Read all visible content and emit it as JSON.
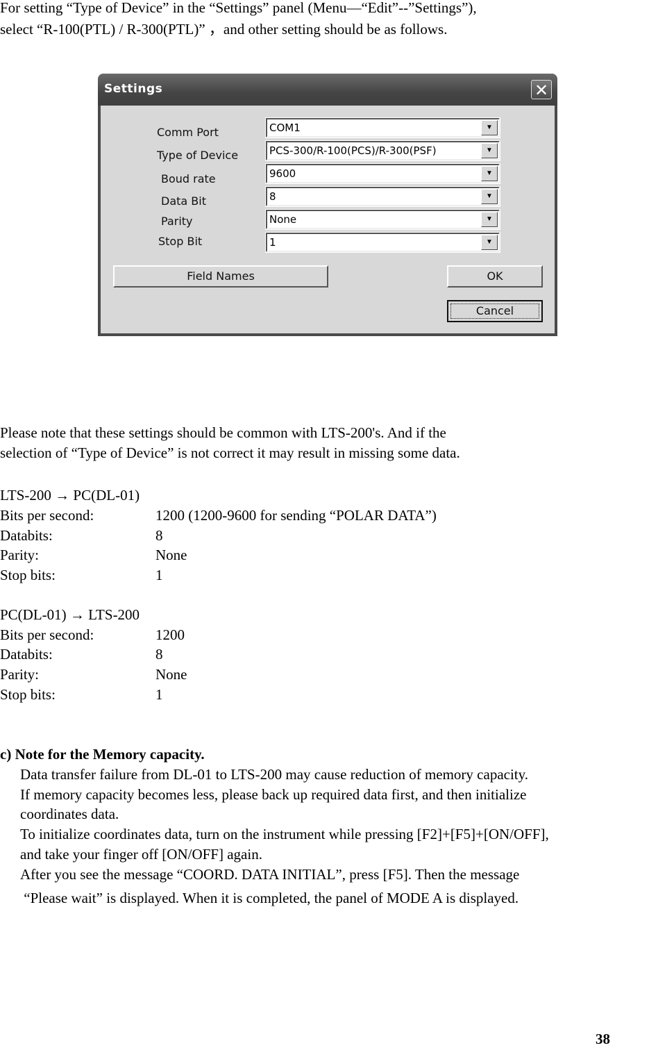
{
  "intro": {
    "line1": "For setting “Type of Device” in the “Settings” panel (Menu—“Edit”--”Settings”),",
    "line2": "select “R-100(PTL) / R-300(PTL)” ，and other setting should be as follows."
  },
  "dialog": {
    "title": "Settings",
    "close_icon": "✕",
    "fields": [
      {
        "label": "Comm Port",
        "value": "COM1"
      },
      {
        "label": "Type of Device",
        "value": "PCS-300/R-100(PCS)/R-300(PSF)"
      },
      {
        "label": "Boud rate",
        "value": "9600"
      },
      {
        "label": "Data Bit",
        "value": "8"
      },
      {
        "label": "Parity",
        "value": "None"
      },
      {
        "label": "Stop Bit",
        "value": "1"
      }
    ],
    "dropdown_arrow": "▼",
    "field_names_button": "Field Names",
    "ok_button": "OK",
    "cancel_button": "Cancel"
  },
  "note": {
    "line1": "Please note that these settings should be common with LTS-200's. And if the",
    "line2": "selection of “Type of Device” is not correct it may result in missing some data."
  },
  "section1": {
    "heading": "LTS-200  →   PC(DL-01)",
    "rows": [
      {
        "label": "Bits per second:",
        "value": "1200 (1200-9600 for sending “POLAR DATA”)"
      },
      {
        "label": "Databits:",
        "value": "8"
      },
      {
        "label": "Parity:",
        "value": "None"
      },
      {
        "label": "Stop bits:",
        "value": "1"
      }
    ]
  },
  "section2": {
    "heading": "PC(DL-01)  →  LTS-200",
    "rows": [
      {
        "label": "Bits per second:",
        "value": "1200"
      },
      {
        "label": "Databits:",
        "value": "8"
      },
      {
        "label": "Parity:",
        "value": "None"
      },
      {
        "label": "Stop bits:",
        "value": "1"
      }
    ]
  },
  "memory": {
    "heading": "c) Note for the Memory capacity.",
    "lines": [
      "Data transfer failure from DL-01 to LTS-200 may cause reduction of memory capacity.",
      "If memory capacity becomes less, please back up required data first, and then initialize",
      "coordinates data.",
      "To initialize coordinates data, turn on the instrument while pressing [F2]+[F5]+[ON/OFF],",
      "and take your finger off [ON/OFF] again.",
      "After you see the message “COORD. DATA INITIAL”, press [F5]. Then the message",
      " “Please wait” is displayed. When it is completed, the panel of MODE A is displayed."
    ]
  },
  "page_number": "38"
}
